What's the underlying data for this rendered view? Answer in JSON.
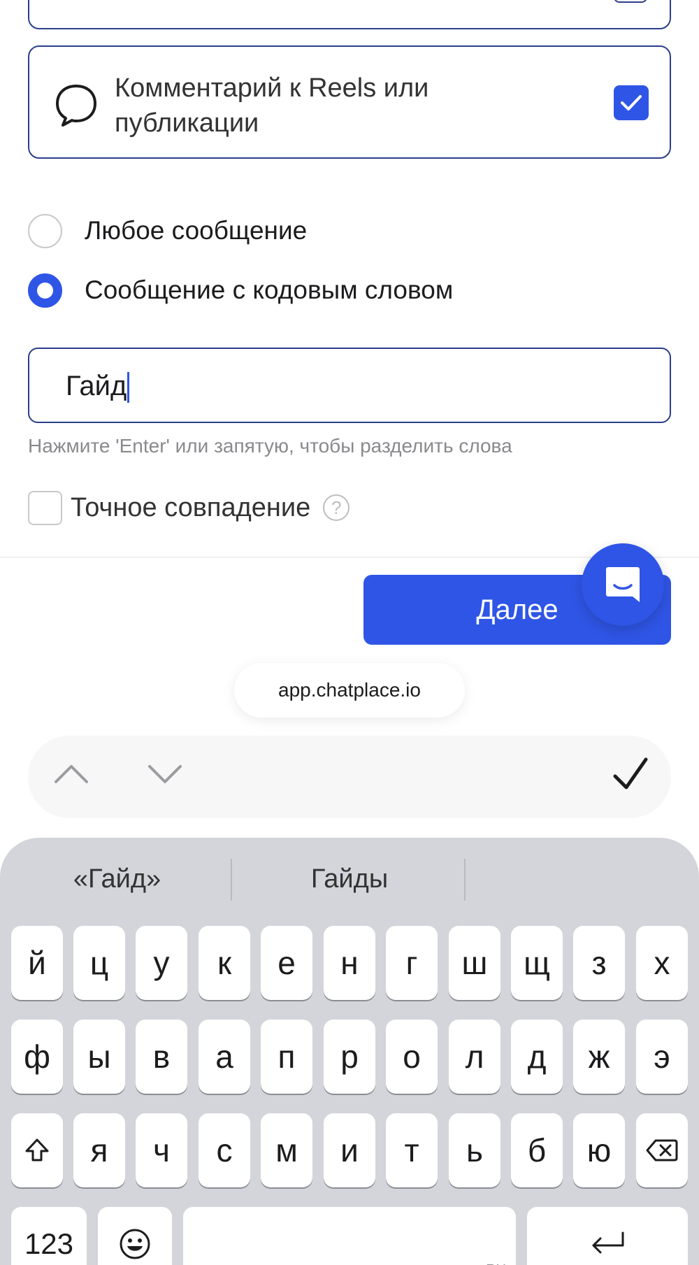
{
  "trigger_cards": {
    "reels_comment": {
      "label": "Комментарий к Reels или публикации",
      "checked": true,
      "icon": "comment-bubble-icon"
    }
  },
  "message_options": [
    {
      "label": "Любое сообщение",
      "selected": false
    },
    {
      "label": "Сообщение с кодовым словом",
      "selected": true
    }
  ],
  "keyword_input": {
    "value": "Гайд"
  },
  "hint_text": "Нажмите 'Enter' или запятую, чтобы разделить слова",
  "exact_match": {
    "label": "Точное совпадение",
    "checked": false,
    "help_icon": "?"
  },
  "next_button": {
    "label": "Далее"
  },
  "browser": {
    "url": "app.chatplace.io"
  },
  "keyboard": {
    "suggestions": [
      "«Гайд»",
      "Гайды",
      ""
    ],
    "row1": [
      "й",
      "ц",
      "у",
      "к",
      "е",
      "н",
      "г",
      "ш",
      "щ",
      "з",
      "х"
    ],
    "row2": [
      "ф",
      "ы",
      "в",
      "а",
      "п",
      "р",
      "о",
      "л",
      "д",
      "ж",
      "э"
    ],
    "row3": [
      "я",
      "ч",
      "с",
      "м",
      "и",
      "т",
      "ь",
      "б",
      "ю"
    ],
    "numbers_key": "123",
    "space_lang": "RU"
  },
  "colors": {
    "accent": "#2f55e6",
    "border": "#2b3f8c",
    "keyboard_bg": "#d3d5db"
  }
}
